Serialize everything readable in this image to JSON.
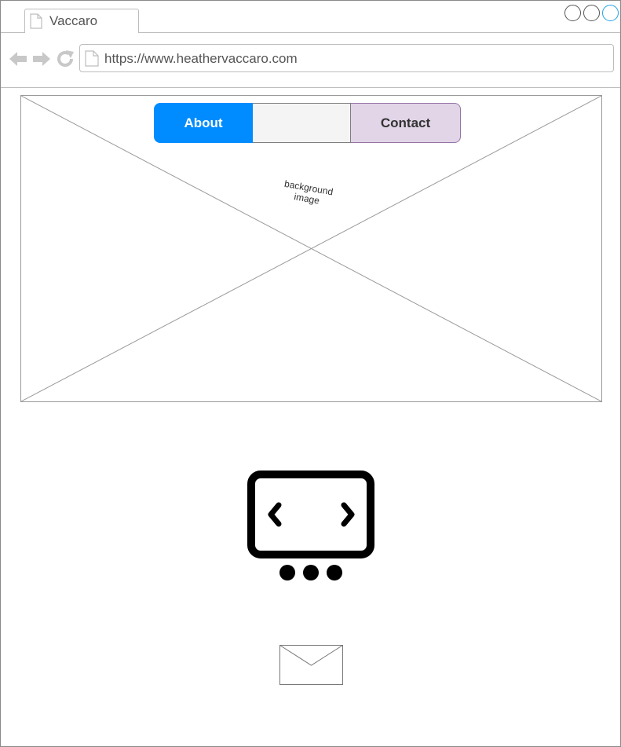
{
  "browser": {
    "tab_title": "Vaccaro",
    "url": "https://www.heathervaccaro.com",
    "icons": {
      "tab": "document-icon",
      "back": "arrow-left-icon",
      "forward": "arrow-right-icon",
      "reload": "reload-icon",
      "url": "document-icon"
    },
    "window_controls": [
      "minimize",
      "restore",
      "maximize"
    ]
  },
  "hero": {
    "placeholder_label": "background image"
  },
  "nav": {
    "about_label": "About",
    "middle_label": "",
    "contact_label": "Contact"
  },
  "colors": {
    "about_bg": "#008cff",
    "contact_bg": "#e1d5e7",
    "contact_border": "#9673a6",
    "maximize_border": "#1ea1e6"
  },
  "content": {
    "carousel_icon": "carousel-icon",
    "mail_icon": "envelope-icon"
  }
}
